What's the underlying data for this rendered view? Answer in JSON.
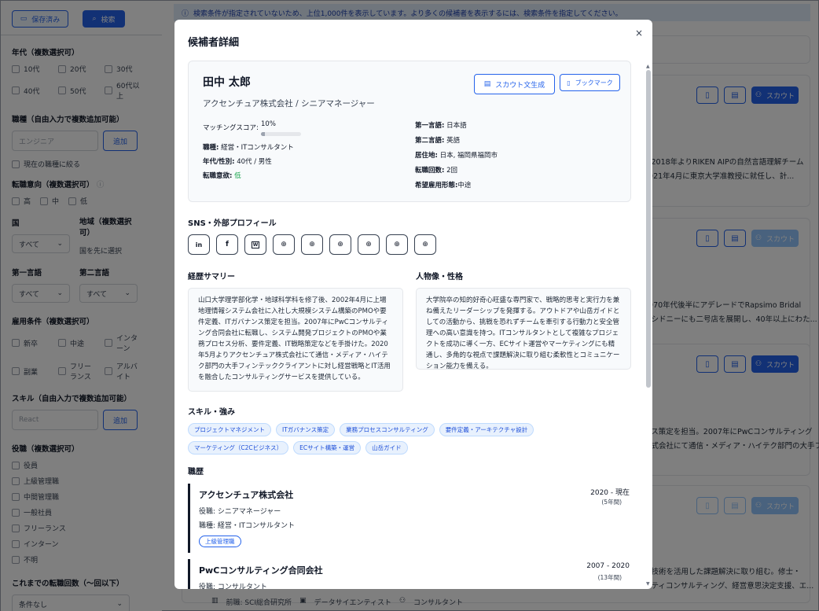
{
  "sidebar": {
    "saved_label": "保存済み",
    "search_label": "検索",
    "age": {
      "title": "年代（複数選択可）",
      "options": [
        "10代",
        "20代",
        "30代",
        "40代",
        "50代",
        "60代以上"
      ]
    },
    "job_type": {
      "title": "職種（自由入力で複数追加可能）",
      "placeholder": "エンジニア",
      "add_label": "追加",
      "current_only": "現在の職種に絞る"
    },
    "intent": {
      "title": "転職意向（複数選択可）",
      "options": [
        "高",
        "中",
        "低"
      ]
    },
    "country": {
      "title": "国",
      "value": "すべて"
    },
    "region": {
      "title": "地域（複数選択可）",
      "hint": "国を先に選択"
    },
    "lang1": {
      "title": "第一言語",
      "value": "すべて"
    },
    "lang2": {
      "title": "第二言語",
      "value": "すべて"
    },
    "employment": {
      "title": "雇用条件（複数選択可）",
      "options": [
        "新卒",
        "中途",
        "インターン",
        "副業",
        "フリーランス",
        "アルバイト"
      ]
    },
    "skill": {
      "title": "スキル（自由入力で複数追加可能）",
      "placeholder": "React",
      "add_label": "追加"
    },
    "position": {
      "title": "役職（複数選択可）",
      "options": [
        "役員",
        "上級管理職",
        "中間管理職",
        "一般社員",
        "フリーランス",
        "インターン",
        "不明"
      ]
    },
    "changes": {
      "title": "これまでの転職回数（〜回以下）",
      "value": "条件なし"
    }
  },
  "main": {
    "notice": "検索条件が指定されていないため、上位1,000件を表示しています。より多くの候補者を表示するには、検索条件を指定してください。",
    "scout_label": "スカウト",
    "cards": [
      {
        "lines": [
          "。2018年よりRIKEN AIPの自然言語理解チーム",
          "2021年4月に東京大学准教授に就任し、計..."
        ]
      },
      {
        "lines": [
          "1970年代後半にアデレードでRapsimo Bridal",
          "にシドニーにも二号店を展開し、40年以上にわた..."
        ]
      },
      {
        "lines": [
          "ンス策定を担当。2007年にPwCコンサルティング",
          "株式会社にて通信・メディア・ハイテク部門の大手フィ..."
        ]
      },
      {
        "lines": [
          "測技術を活用した課題解決に取り組む。修士・",
          "リティコンサルティング、経営意思決定支援、エ..."
        ]
      }
    ],
    "bottom": [
      "前職: SCI総合研究所",
      "データサイエンティスト",
      "コンサルタント"
    ]
  },
  "modal": {
    "title": "候補者詳細",
    "close": "×",
    "name": "田中 太郎",
    "company_role": "アクセンチュア株式会社 / シニアマネージャー",
    "scout_doc_label": "スカウト文生成",
    "bookmark_label": "ブックマーク",
    "matching_label": "マッチングスコア:",
    "matching_value": "10%",
    "matching_fraction": 0.1,
    "left_fields": [
      {
        "k": "職種:",
        "v": "経営・ITコンサルタント"
      },
      {
        "k": "年代/性別:",
        "v": "40代 / 男性"
      },
      {
        "k": "転職意欲:",
        "v": "低"
      }
    ],
    "right_fields": [
      {
        "k": "第一言語:",
        "v": "日本語"
      },
      {
        "k": "第二言語:",
        "v": "英語"
      },
      {
        "k": "居住地:",
        "v": "日本, 福岡県福岡市"
      },
      {
        "k": "転職回数:",
        "v": "2回"
      },
      {
        "k": "希望雇用形態:",
        "v": "中途"
      }
    ],
    "sns_title": "SNS・外部プロフィール",
    "sns_icons": [
      "linkedin-icon",
      "facebook-icon",
      "wantedly-icon",
      "globe-icon",
      "globe-icon",
      "globe-icon",
      "globe-icon",
      "globe-icon",
      "globe-icon"
    ],
    "summary_title": "経歴サマリー",
    "summary_text": "山口大学理学部化学・地球科学科を修了後、2002年4月に上場地理情報システム会社に入社し大規模システム構築のPMOや要件定義、ITガバナンス策定を担当。2007年にPwCコンサルティング合同会社に転職し、システム開発プロジェクトのPMOや業務プロセス分析、要件定義、IT戦略策定などを手掛けた。2020年5月よりアクセンチュア株式会社にて通信・メディア・ハイテク部門の大手フィンテッククライアントに対し経営戦略とIT活用を融合したコンサルティングサービスを提供している。",
    "persona_title": "人物像・性格",
    "persona_text": "大学院卒の知的好奇心旺盛な専門家で、戦略的思考と実行力を兼ね備えたリーダーシップを発揮する。アウトドアや山岳ガイドとしての活動から、挑戦を恐れずチームを牽引する行動力と安全管理への高い意識を持つ。ITコンサルタントとして複雑なプロジェクトを成功に導く一方、ECサイト運営やマーケティングにも精通し、多角的な視点で課題解決に取り組む柔軟性とコミュニケーション能力を備える。",
    "skills_title": "スキル・強み",
    "skills": [
      "プロジェクトマネジメント",
      "ITガバナンス策定",
      "業務プロセスコンサルティング",
      "要件定義・アーキテクチャ設計",
      "マーケティング（C2Cビジネス）",
      "ECサイト構築・運営",
      "山岳ガイド"
    ],
    "career_title": "職歴",
    "jobs": [
      {
        "company": "アクセンチュア株式会社",
        "period": "2020 - 現在",
        "duration": "(5年間)",
        "role": "役職: シニアマネージャー",
        "job": "職種: 経営・ITコンサルタント",
        "tag": "上級管理職"
      },
      {
        "company": "PwCコンサルティング合同会社",
        "period": "2007 - 2020",
        "duration": "(13年間)",
        "role": "役職: コンサルタント"
      }
    ]
  }
}
